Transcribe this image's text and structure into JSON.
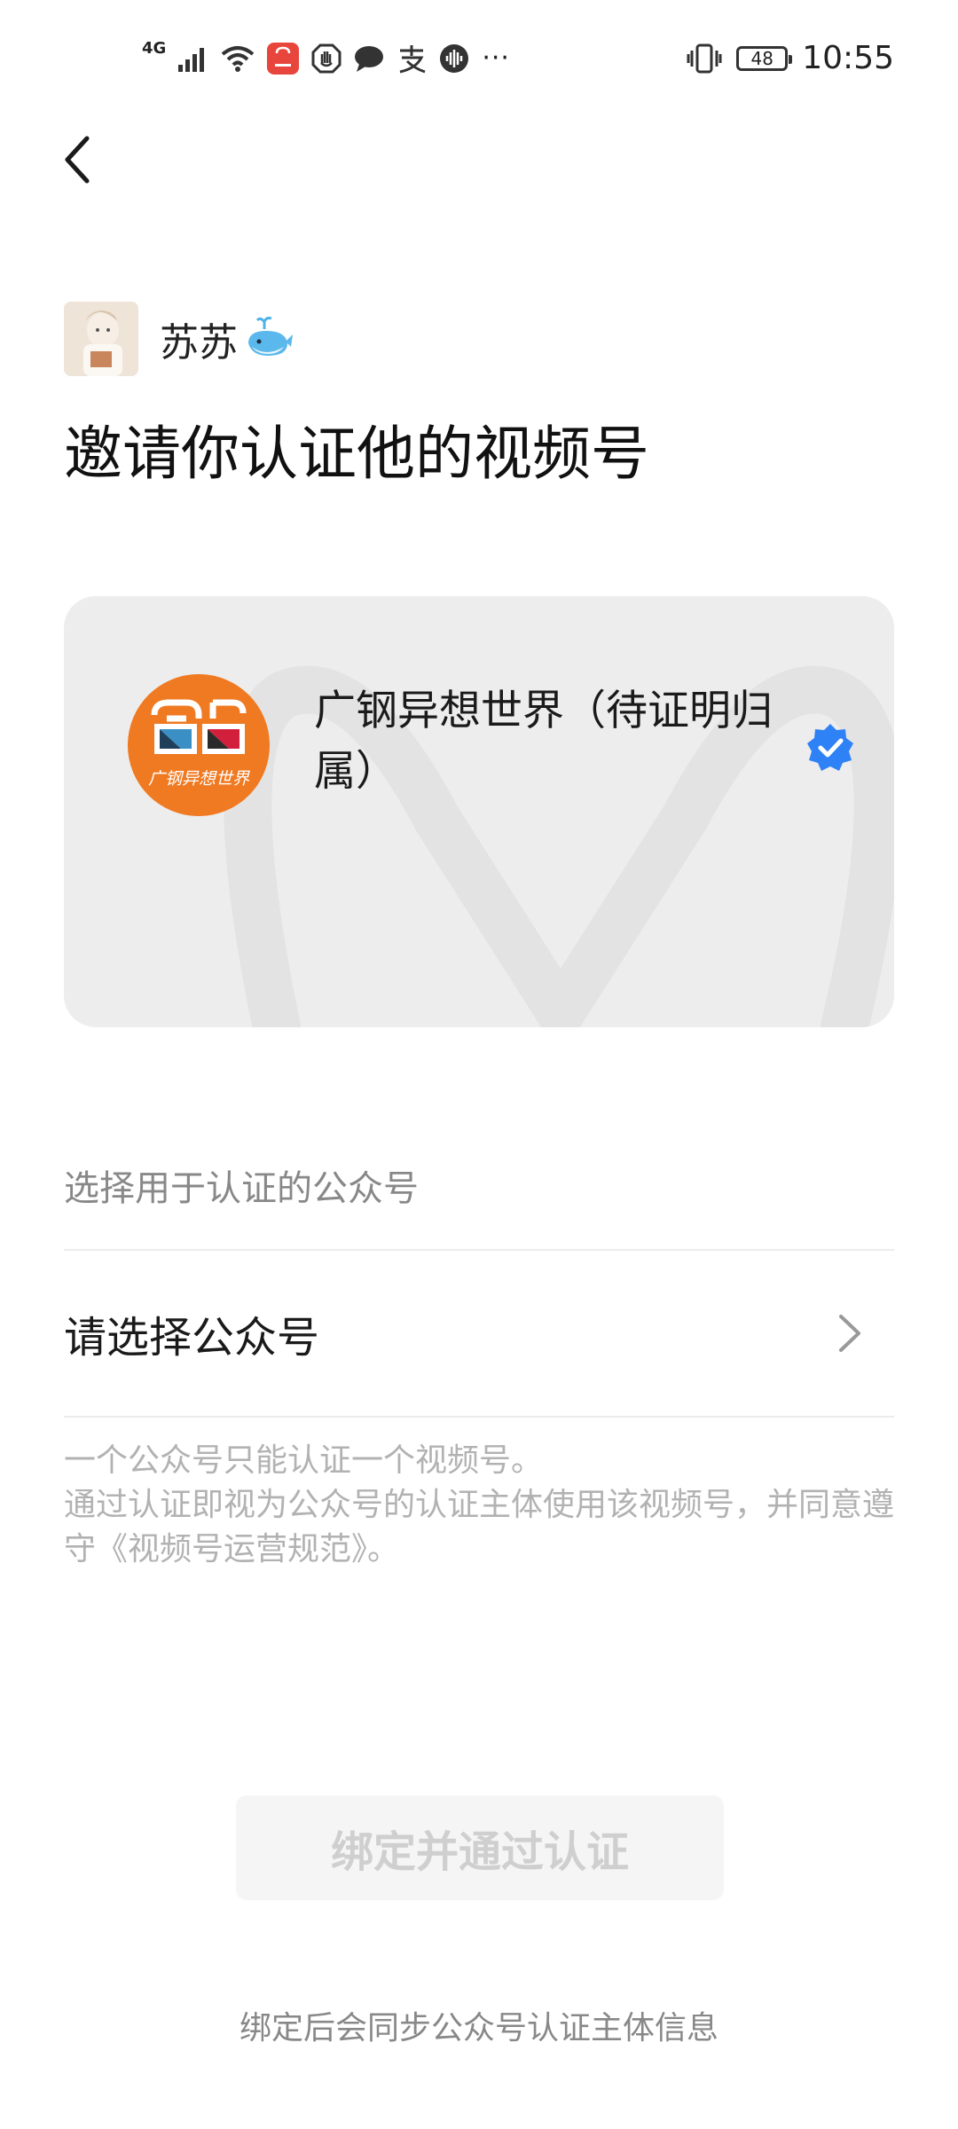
{
  "status_bar": {
    "network": "4G",
    "more": "···",
    "battery_level": "48",
    "time": "10:55",
    "icons": [
      "signal-icon",
      "wifi-icon",
      "huawei-app-icon",
      "hand-icon",
      "chat-bubble-icon",
      "alipay-icon",
      "soundwave-icon",
      "vibrate-icon",
      "battery-icon"
    ]
  },
  "header": {
    "back_icon": "chevron-left-icon"
  },
  "inviter": {
    "name": "苏苏",
    "emoji": "🐳"
  },
  "page": {
    "title": "邀请你认证他的视频号"
  },
  "channel": {
    "name": "广钢异想世界（待证明归属）",
    "logo_text": "广钢异想世界",
    "logo_color": "#f07a22",
    "verified_color": "#2f82f5"
  },
  "select": {
    "section_label": "选择用于认证的公众号",
    "placeholder": "请选择公众号"
  },
  "notes": {
    "line1": "一个公众号只能认证一个视频号。",
    "line2": "通过认证即视为公众号的认证主体使用该视频号，并同意遵守《视频号运营规范》。"
  },
  "actions": {
    "bind_label": "绑定并通过认证"
  },
  "footer": {
    "note": "绑定后会同步公众号认证主体信息"
  }
}
